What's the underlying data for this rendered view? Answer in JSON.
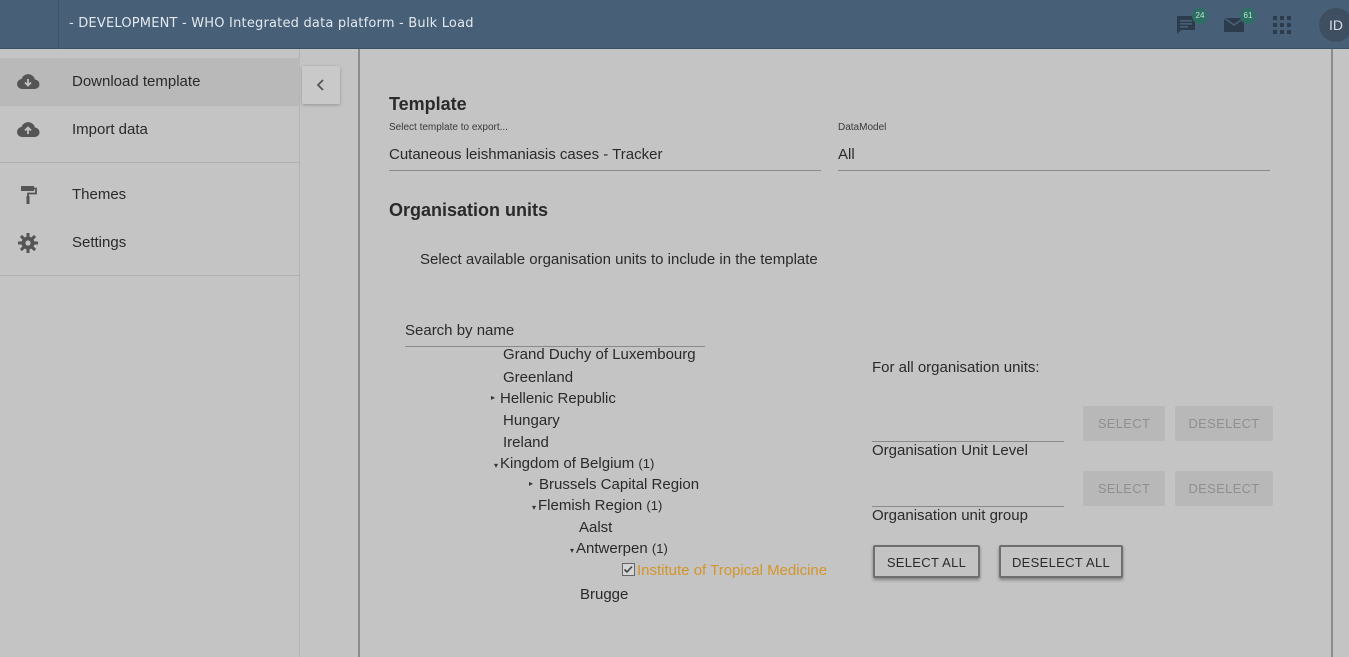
{
  "header": {
    "title": "- DEVELOPMENT - WHO Integrated data platform - Bulk Load",
    "messages_count": "24",
    "interpretations_count": "61",
    "avatar_initials": "ID"
  },
  "sidebar": {
    "items": [
      {
        "label": "Download template",
        "icon": "cloud-download-icon"
      },
      {
        "label": "Import data",
        "icon": "cloud-upload-icon"
      },
      {
        "label": "Themes",
        "icon": "paint-roller-icon"
      },
      {
        "label": "Settings",
        "icon": "gear-icon"
      }
    ]
  },
  "template_section": {
    "heading": "Template",
    "template_label": "Select template to export...",
    "template_value": "Cutaneous leishmaniasis cases - Tracker",
    "datamodel_label": "DataModel",
    "datamodel_value": "All"
  },
  "org_units": {
    "heading": "Organisation units",
    "instructions": "Select available organisation units to include in the template",
    "search_placeholder": "Search by name",
    "tree": [
      {
        "label": "Grand Duchy of Luxembourg",
        "count": ""
      },
      {
        "label": "Greenland",
        "count": ""
      },
      {
        "label": "Hellenic Republic",
        "count": ""
      },
      {
        "label": "Hungary",
        "count": ""
      },
      {
        "label": "Ireland",
        "count": ""
      },
      {
        "label": "Kingdom of Belgium",
        "count": "(1)"
      },
      {
        "label": "Brussels Capital Region",
        "count": ""
      },
      {
        "label": "Flemish Region",
        "count": "(1)"
      },
      {
        "label": "Aalst",
        "count": ""
      },
      {
        "label": "Antwerpen",
        "count": "(1)"
      },
      {
        "label": "Institute of Tropical Medicine",
        "count": ""
      },
      {
        "label": "Brugge",
        "count": ""
      }
    ],
    "for_all_label": "For all organisation units:",
    "level_label": "Organisation Unit Level",
    "group_label": "Organisation unit group",
    "select_label": "SELECT",
    "deselect_label": "DESELECT",
    "select_all_label": "SELECT ALL",
    "deselect_all_label": "DESELECT ALL"
  },
  "colors": {
    "header_bg": "#476078",
    "selected_item": "#d4952a",
    "overlay_bg": "#c4c4c4"
  }
}
